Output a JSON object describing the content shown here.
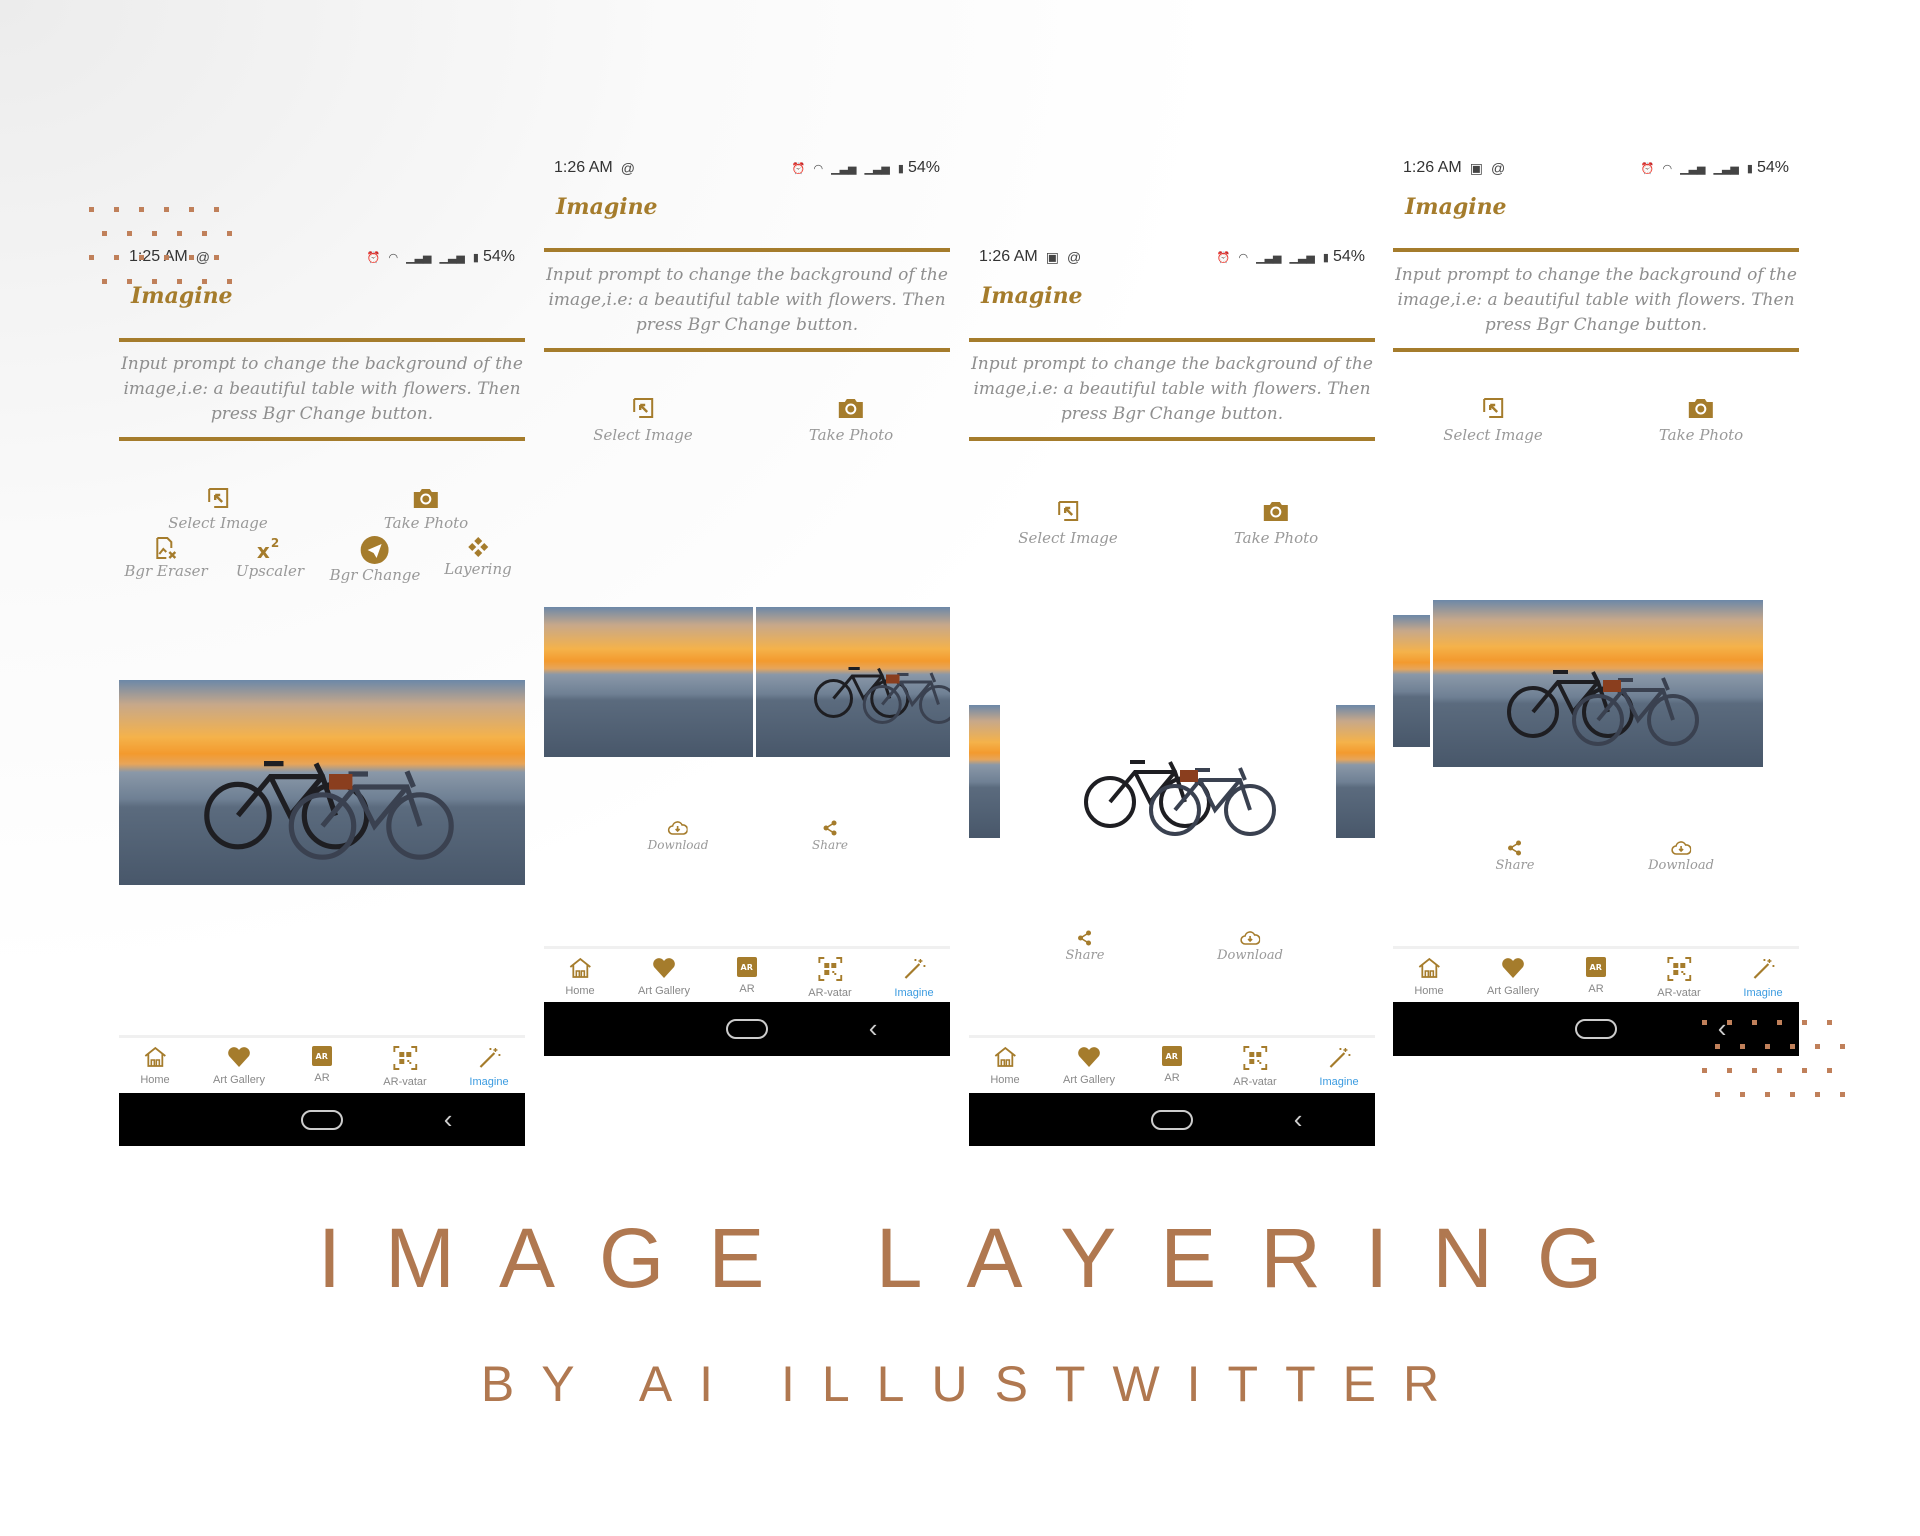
{
  "colors": {
    "accent": "#a57c2c",
    "headline": "#b07850",
    "nav_active": "#3b9be0",
    "label_gray": "#999999",
    "system_bar": "#000000"
  },
  "headline": {
    "title": "IMAGE LAYERING",
    "subtitle": "BY AI ILLUSTWITTER"
  },
  "nav": [
    {
      "label": "Home",
      "icon": "home-icon"
    },
    {
      "label": "Art Gallery",
      "icon": "heart-icon"
    },
    {
      "label": "AR",
      "icon": "ar-icon"
    },
    {
      "label": "AR-vatar",
      "icon": "qr-code-icon"
    },
    {
      "label": "Imagine",
      "icon": "magic-wand-icon",
      "active": true
    }
  ],
  "screens": [
    {
      "status": {
        "time": "1:25 AM",
        "battery": "54%"
      },
      "app_title": "Imagine",
      "prompt": "Input prompt to change the background of the image,i.e: a beautiful table with flowers. Then press Bgr Change button.",
      "actions": [
        {
          "label": "Select Image",
          "icon": "select-image-icon"
        },
        {
          "label": "Take Photo",
          "icon": "camera-icon"
        }
      ],
      "tools": [
        {
          "label": "Bgr Eraser",
          "icon": "image-eraser-icon"
        },
        {
          "label": "Upscaler",
          "icon": "superscript-x2-icon"
        },
        {
          "label": "Bgr Change",
          "icon": "send-icon"
        },
        {
          "label": "Layering",
          "icon": "layers-diamond-icon"
        }
      ],
      "result_actions": []
    },
    {
      "status": {
        "time": "1:26 AM",
        "battery": "54%"
      },
      "app_title": "Imagine",
      "prompt": "Input prompt to change the background of the image,i.e: a beautiful table with flowers. Then press Bgr Change button.",
      "actions": [
        {
          "label": "Select Image",
          "icon": "select-image-icon"
        },
        {
          "label": "Take Photo",
          "icon": "camera-icon"
        }
      ],
      "tools": [],
      "result_actions": [
        {
          "label": "Download",
          "icon": "cloud-download-icon"
        },
        {
          "label": "Share",
          "icon": "share-icon"
        }
      ]
    },
    {
      "status": {
        "time": "1:26 AM",
        "battery": "54%"
      },
      "app_title": "Imagine",
      "prompt": "Input prompt to change the background of the image,i.e: a beautiful table with flowers. Then press Bgr Change button.",
      "actions": [
        {
          "label": "Select Image",
          "icon": "select-image-icon"
        },
        {
          "label": "Take Photo",
          "icon": "camera-icon"
        }
      ],
      "tools": [],
      "result_actions": [
        {
          "label": "Share",
          "icon": "share-icon"
        },
        {
          "label": "Download",
          "icon": "cloud-download-icon"
        }
      ]
    },
    {
      "status": {
        "time": "1:26 AM",
        "battery": "54%"
      },
      "app_title": "Imagine",
      "prompt": "Input prompt to change the background of the image,i.e: a beautiful table with flowers. Then press Bgr Change button.",
      "actions": [
        {
          "label": "Select Image",
          "icon": "select-image-icon"
        },
        {
          "label": "Take Photo",
          "icon": "camera-icon"
        }
      ],
      "tools": [],
      "result_actions": [
        {
          "label": "Share",
          "icon": "share-icon"
        },
        {
          "label": "Download",
          "icon": "cloud-download-icon"
        }
      ]
    }
  ]
}
